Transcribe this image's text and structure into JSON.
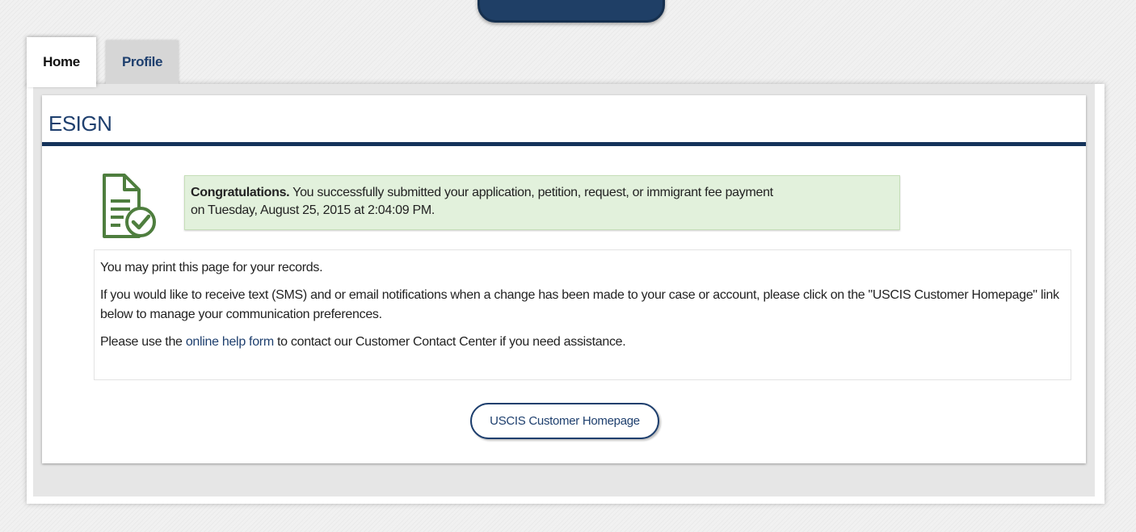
{
  "tabs": {
    "home_label": "Home",
    "profile_label": "Profile"
  },
  "page": {
    "title": "ESIGN"
  },
  "alert": {
    "strong_text": "Congratulations.",
    "message_line1": " You successfully submitted your application, petition, request, or immigrant fee payment",
    "message_line2": "on Tuesday, August 25, 2015 at 2:04:09 PM."
  },
  "info": {
    "print_note": "You may print this page for your records.",
    "notifications_text": "If you would like to receive text (SMS) and or email notifications when a change has been made to your case or account, please click on the \"USCIS Customer Homepage\" link below to manage your communication preferences.",
    "help_prefix": "Please use the ",
    "help_link": "online help form",
    "help_suffix": " to contact our Customer Contact Center if you need assistance."
  },
  "actions": {
    "homepage_button": "USCIS Customer Homepage"
  },
  "icons": {
    "document": "document-check-icon"
  },
  "colors": {
    "brand_navy": "#1e3f6e",
    "rule_navy": "#15335a",
    "success_bg": "#e2f1dc",
    "icon_green": "#4e7e3e"
  }
}
